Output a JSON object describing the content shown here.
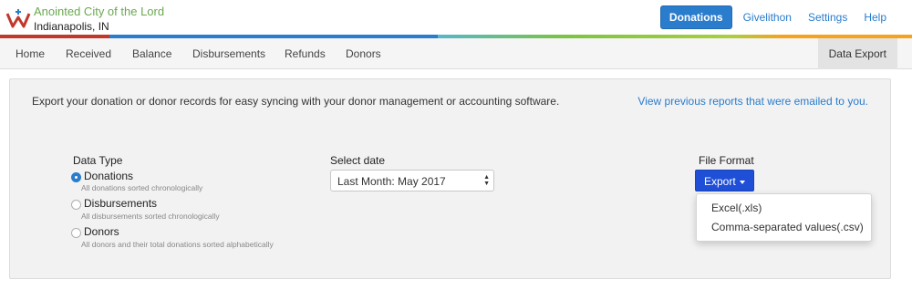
{
  "header": {
    "org_name": "Anointed City of the Lord",
    "org_location": "Indianapolis, IN",
    "nav": {
      "donations": "Donations",
      "givelithon": "Givelithon",
      "settings": "Settings",
      "help": "Help"
    }
  },
  "subnav": {
    "home": "Home",
    "received": "Received",
    "balance": "Balance",
    "disbursements": "Disbursements",
    "refunds": "Refunds",
    "donors": "Donors",
    "active": "Data Export"
  },
  "panel": {
    "intro": "Export your donation or donor records for easy syncing with your donor management or accounting software.",
    "previous_reports_link": "View previous reports that were emailed to you.",
    "data_type": {
      "label": "Data Type",
      "options": [
        {
          "label": "Donations",
          "description": "All donations sorted chronologically",
          "selected": true
        },
        {
          "label": "Disbursements",
          "description": "All disbursements sorted chronologically",
          "selected": false
        },
        {
          "label": "Donors",
          "description": "All donors and their total donations sorted alphabetically",
          "selected": false
        }
      ]
    },
    "select_date": {
      "label": "Select date",
      "value": "Last Month: May 2017"
    },
    "file_format": {
      "label": "File Format",
      "button": "Export",
      "options": [
        "Excel(.xls)",
        "Comma-separated values(.csv)"
      ]
    }
  },
  "colors": {
    "brand_green": "#6aa84f",
    "brand_blue": "#2a7ccc",
    "export_blue": "#1e4fd6"
  }
}
